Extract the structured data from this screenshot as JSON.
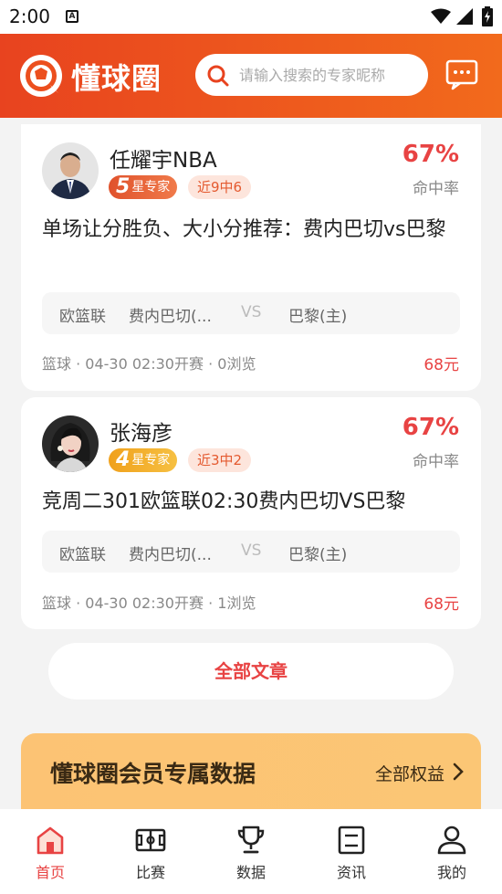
{
  "status_bar": {
    "time": "2:00",
    "sim_label": "A"
  },
  "header": {
    "logo_text": "懂球圈",
    "search_placeholder": "请输入搜索的专家昵称"
  },
  "articles": [
    {
      "expert_name": "任耀宇NBA",
      "level_num": "5",
      "level_label": "星专家",
      "streak": "近9中6",
      "hit_rate": "67%",
      "hit_rate_label": "命中率",
      "title": "单场让分胜负、大小分推荐：费内巴切vs巴黎",
      "league": "欧篮联",
      "home": "费内巴切(...",
      "vs": "VS",
      "away": "巴黎(主)",
      "sport": "篮球",
      "dot1": "·",
      "start_time": "04-30 02:30开赛",
      "dot2": "·",
      "views": "0浏览",
      "price": "68元"
    },
    {
      "expert_name": "张海彦",
      "level_num": "4",
      "level_label": "星专家",
      "streak": "近3中2",
      "hit_rate": "67%",
      "hit_rate_label": "命中率",
      "title": "竞周二301欧篮联02:30费内巴切VS巴黎",
      "league": "欧篮联",
      "home": "费内巴切(...",
      "vs": "VS",
      "away": "巴黎(主)",
      "sport": "篮球",
      "dot1": "·",
      "start_time": "04-30 02:30开赛",
      "dot2": "·",
      "views": "1浏览",
      "price": "68元"
    }
  ],
  "all_articles_label": "全部文章",
  "vip": {
    "title": "懂球圈会员专属数据",
    "link": "全部权益"
  },
  "tabs": [
    {
      "label": "首页",
      "icon": "home-icon"
    },
    {
      "label": "比赛",
      "icon": "field-icon"
    },
    {
      "label": "数据",
      "icon": "trophy-icon"
    },
    {
      "label": "资讯",
      "icon": "news-icon"
    },
    {
      "label": "我的",
      "icon": "user-icon"
    }
  ],
  "colors": {
    "brand": "#ec4f1e",
    "accent_red": "#e84343",
    "vip_bg": "#fbc675"
  }
}
